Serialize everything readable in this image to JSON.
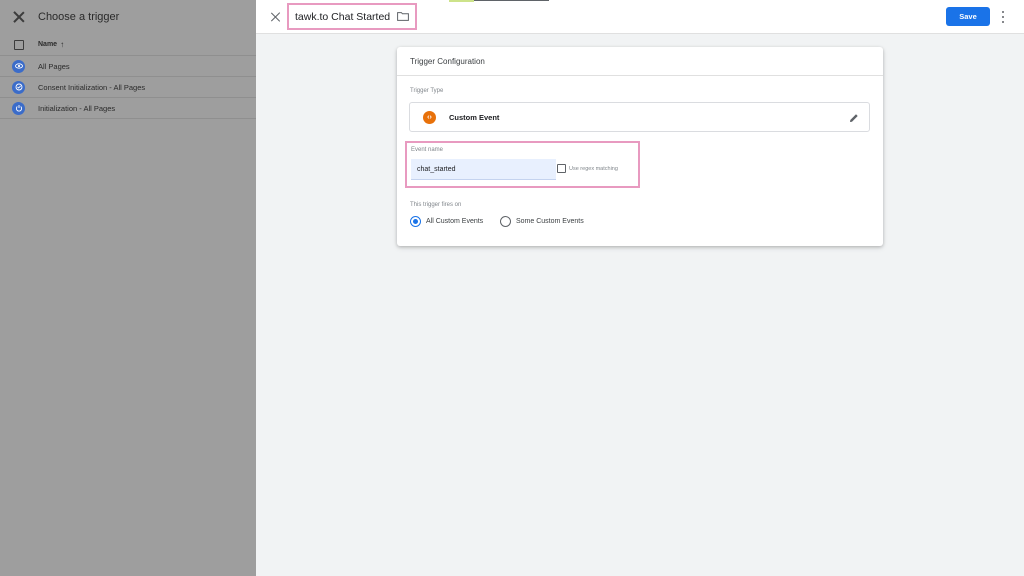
{
  "left_panel": {
    "title": "Choose a trigger",
    "column_name": "Name",
    "triggers": [
      {
        "label": "All Pages",
        "icon": "eye-icon"
      },
      {
        "label": "Consent Initialization - All Pages",
        "icon": "consent-icon"
      },
      {
        "label": "Initialization - All Pages",
        "icon": "power-icon"
      }
    ]
  },
  "header": {
    "title": "tawk.to Chat Started",
    "save_label": "Save"
  },
  "card": {
    "heading": "Trigger Configuration",
    "trigger_type_label": "Trigger Type",
    "trigger_type_value": "Custom Event",
    "event_name_label": "Event name",
    "event_name_value": "chat_started",
    "regex_label": "Use regex matching",
    "fires_on_label": "This trigger fires on",
    "options": [
      "All Custom Events",
      "Some Custom Events"
    ],
    "selected_option": "All Custom Events"
  },
  "colors": {
    "accent": "#1a73e8",
    "highlight": "#e89ac0",
    "custom_event_icon": "#e8710a",
    "trigger_icon": "#3b6cc9"
  }
}
